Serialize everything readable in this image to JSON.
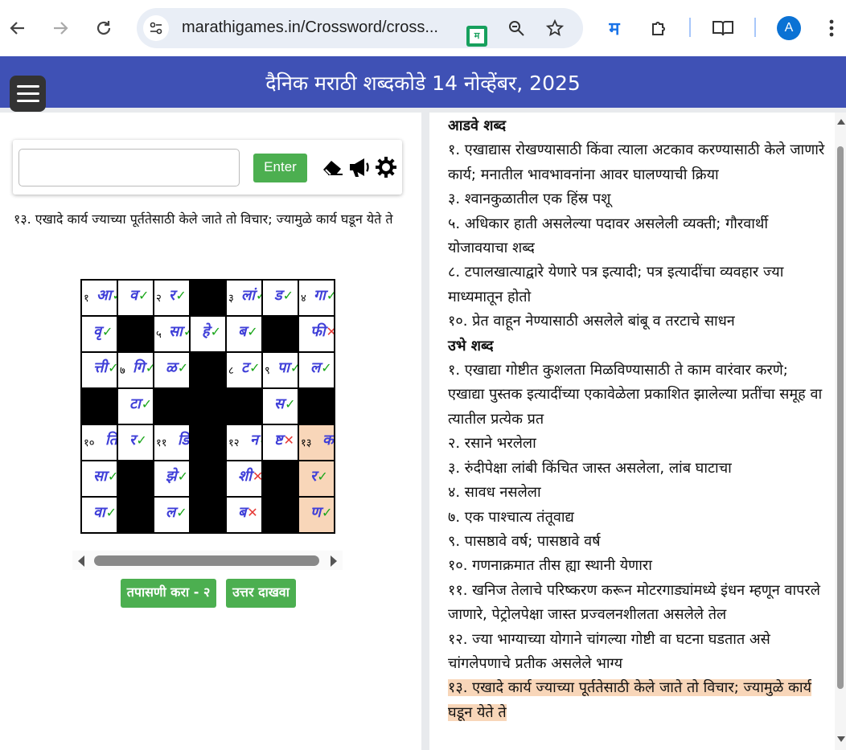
{
  "browser": {
    "url": "marathigames.in/Crossword/cross...",
    "extension_badge": "म",
    "avatar_letter": "A",
    "accent_color": "#0b57d0"
  },
  "header": {
    "title": "दैनिक मराठी शब्दकोडे 14 नोव्हेंबर, 2025",
    "bg_color": "#3f51b5"
  },
  "entry": {
    "value": "",
    "enter_label": "Enter",
    "icons": [
      "eraser-icon",
      "megaphone-icon",
      "settings-icon"
    ]
  },
  "current_clue": "१३. एखादे कार्य ज्याच्या पूर्ततेसाठी केले जाते तो विचार; ज्यामुळे कार्य घडून येते ते",
  "grid": {
    "rows": [
      [
        {
          "n": "१",
          "l": "आ",
          "m": "ok"
        },
        {
          "n": "",
          "l": "व",
          "m": "ok"
        },
        {
          "n": "२",
          "l": "र",
          "m": "ok"
        },
        {
          "black": true
        },
        {
          "n": "३",
          "l": "लां",
          "m": "ok"
        },
        {
          "n": "",
          "l": "ड",
          "m": "ok"
        },
        {
          "n": "४",
          "l": "गा",
          "m": "ok"
        }
      ],
      [
        {
          "n": "",
          "l": "वृ",
          "m": "ok"
        },
        {
          "black": true
        },
        {
          "n": "५",
          "l": "सा",
          "m": "ok"
        },
        {
          "n": "",
          "l": "हे",
          "m": "ok"
        },
        {
          "n": "",
          "l": "ब",
          "m": "ok"
        },
        {
          "black": true
        },
        {
          "n": "",
          "l": "फी",
          "m": "bad"
        }
      ],
      [
        {
          "n": "",
          "l": "त्ती",
          "m": "ok"
        },
        {
          "n": "७",
          "l": "गि",
          "m": "ok"
        },
        {
          "n": "",
          "l": "ळ",
          "m": "ok"
        },
        {
          "black": true
        },
        {
          "n": "८",
          "l": "ट",
          "m": "ok"
        },
        {
          "n": "९",
          "l": "पा",
          "m": "ok"
        },
        {
          "n": "",
          "l": "ल",
          "m": "ok"
        }
      ],
      [
        {
          "black": true
        },
        {
          "n": "",
          "l": "टा",
          "m": "ok"
        },
        {
          "black": true
        },
        {
          "black": true
        },
        {
          "black": true
        },
        {
          "n": "",
          "l": "स",
          "m": "ok"
        },
        {
          "black": true
        }
      ],
      [
        {
          "n": "१०",
          "l": "ति",
          "m": "ok"
        },
        {
          "n": "",
          "l": "र",
          "m": "ok"
        },
        {
          "n": "११",
          "l": "डि",
          "m": ""
        },
        {
          "black": true
        },
        {
          "n": "१२",
          "l": "न",
          "m": "ok"
        },
        {
          "n": "",
          "l": "ष्ट",
          "m": "bad"
        },
        {
          "n": "१३",
          "l": "का",
          "m": "ok",
          "hl": true
        }
      ],
      [
        {
          "n": "",
          "l": "सा",
          "m": "ok"
        },
        {
          "black": true
        },
        {
          "n": "",
          "l": "झे",
          "m": "ok"
        },
        {
          "black": true
        },
        {
          "n": "",
          "l": "शी",
          "m": "bad"
        },
        {
          "black": true
        },
        {
          "n": "",
          "l": "र",
          "m": "ok",
          "hl": true
        }
      ],
      [
        {
          "n": "",
          "l": "वा",
          "m": "ok"
        },
        {
          "black": true
        },
        {
          "n": "",
          "l": "ल",
          "m": "ok"
        },
        {
          "black": true
        },
        {
          "n": "",
          "l": "ब",
          "m": "bad"
        },
        {
          "black": true
        },
        {
          "n": "",
          "l": "ण",
          "m": "ok",
          "hl": true
        }
      ]
    ],
    "ok_symbol": "✓",
    "bad_symbol": "✕",
    "ok_color": "#1aa61a",
    "bad_color": "#e53935",
    "highlight_color": "#f8d6b9"
  },
  "buttons": {
    "check_label": "तपासणी करा - २",
    "answer_label": "उत्तर दाखवा"
  },
  "clues": {
    "across_heading": "आडवे शब्द",
    "across": [
      "१. एखाद्यास रोखण्यासाठी किंवा त्याला अटकाव करण्यासाठी केले जाणारे कार्य; मनातील भावभावनांना आवर घालण्याची क्रिया",
      "३. श्वानकुळातील एक हिंस्र पशू",
      "५. अधिकार हाती असलेल्या पदावर असलेली व्यक्ती; गौरवार्थी योजावयाचा शब्द",
      "८. टपालखात्याद्वारे येणारे पत्र इत्यादी; पत्र इत्यादींचा व्यवहार ज्या माध्यमातून होतो",
      "१०. प्रेत वाहून नेण्यासाठी असलेले बांबू व तरटाचे साधन"
    ],
    "down_heading": "उभे शब्द",
    "down": [
      "१. एखाद्या गोष्टीत कुशलता मिळविण्यासाठी ते काम वारंवार करणे; एखाद्या पुस्तक इत्यादींच्या एकावेळेला प्रकाशित झालेल्या प्रतींचा समूह वा त्यातील प्रत्येक प्रत",
      "२. रसाने भरलेला",
      "३. रुंदीपेक्षा लांबी किंचित जास्त असलेला, लांब घाटाचा",
      "४. सावध नसलेला",
      "७. एक पाश्चात्य तंतूवाद्य",
      "९. पासष्ठावे वर्ष; पासष्ठावे वर्ष",
      "१०. गणनाक्रमात तीस ह्या स्थानी येणारा",
      "११. खनिज तेलाचे परिष्करण करून मोटरगाड्यांमध्ये इंधन म्हणून वापरले जाणारे, पेट्रोलपेक्षा जास्त प्रज्वलनशीलता असलेले तेल",
      "१२. ज्या भाग्याच्या योगाने चांगल्या गोष्टी वा घटना घडतात असे चांगलेपणाचे प्रतीक असलेले भाग्य"
    ],
    "active_clue": "१३. एखादे कार्य ज्याच्या पूर्ततेसाठी केले जाते तो विचार; ज्यामुळे कार्य घडून येते ते"
  }
}
